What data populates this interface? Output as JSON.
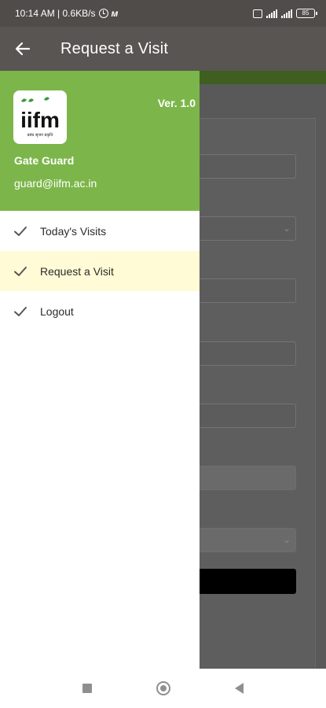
{
  "status_bar": {
    "time_speed": "10:14 AM | 0.6KB/s",
    "battery": "85"
  },
  "app_bar": {
    "title": "Request a Visit",
    "back_icon": "arrow-left-icon"
  },
  "drawer": {
    "version": "Ver. 1.0",
    "user_name": "Gate Guard",
    "user_email": "guard@iifm.ac.in",
    "logo": {
      "text": "iifm",
      "tagline": "प्रबंध सृजन प्रकृति"
    },
    "items": [
      {
        "label": "Today's Visits",
        "icon": "check-icon",
        "active": false
      },
      {
        "label": "Request a Visit",
        "icon": "check-icon",
        "active": true
      },
      {
        "label": "Logout",
        "icon": "check-icon",
        "active": false
      }
    ]
  },
  "colors": {
    "drawer_header": "#7cb64a",
    "active_item": "#fffbd6",
    "app_bar": "#595552"
  }
}
